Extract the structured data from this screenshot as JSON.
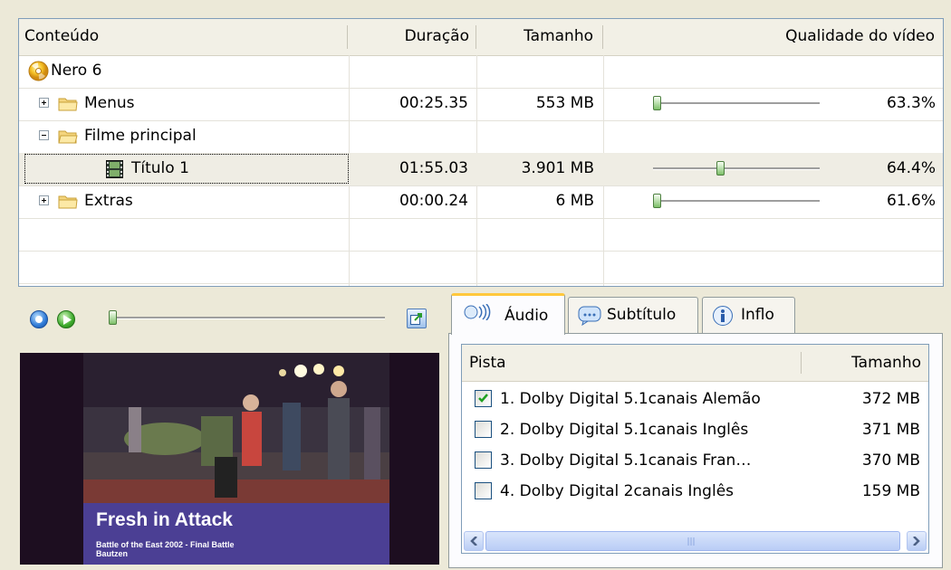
{
  "tree": {
    "columns": {
      "content": "Conteúdo",
      "duration": "Duração",
      "size": "Tamanho",
      "quality": "Qualidade do vídeo"
    },
    "rows": [
      {
        "label": "Nero 6",
        "duration": "",
        "size": "",
        "quality": ""
      },
      {
        "label": "Menus",
        "duration": "00:25.35",
        "size": "553 MB",
        "quality": "63.3%",
        "quality_level": 0.0
      },
      {
        "label": "Filme principal",
        "duration": "",
        "size": "",
        "quality": ""
      },
      {
        "label": "Título 1",
        "duration": "01:55.03",
        "size": "3.901 MB",
        "quality": "64.4%",
        "quality_level": 0.4
      },
      {
        "label": "Extras",
        "duration": "00:00.24",
        "size": "6 MB",
        "quality": "61.6%",
        "quality_level": 0.0
      }
    ]
  },
  "player": {
    "position": 0.0
  },
  "video": {
    "title": "Fresh in Attack",
    "caption_line1": "Battle of the East 2002 - Final Battle",
    "caption_line2": "Bautzen"
  },
  "tabs": [
    {
      "label": "Áudio",
      "active": true
    },
    {
      "label": "Subtítulo",
      "active": false
    },
    {
      "label": "Inflo",
      "active": false
    }
  ],
  "tracks": {
    "columns": {
      "track": "Pista",
      "size": "Tamanho"
    },
    "rows": [
      {
        "label": "1. Dolby Digital 5.1canais Alemão",
        "size": "372 MB",
        "checked": true
      },
      {
        "label": "2. Dolby Digital 5.1canais Inglês",
        "size": "371 MB",
        "checked": false
      },
      {
        "label": "3. Dolby Digital 5.1canais Fran…",
        "size": "370 MB",
        "checked": false
      },
      {
        "label": "4. Dolby Digital 2canais Inglês",
        "size": "159 MB",
        "checked": false
      }
    ]
  },
  "colors": {
    "accent_tab": "#FFC83C",
    "selection_border": "#7F9DB9",
    "check": "#21A121"
  }
}
